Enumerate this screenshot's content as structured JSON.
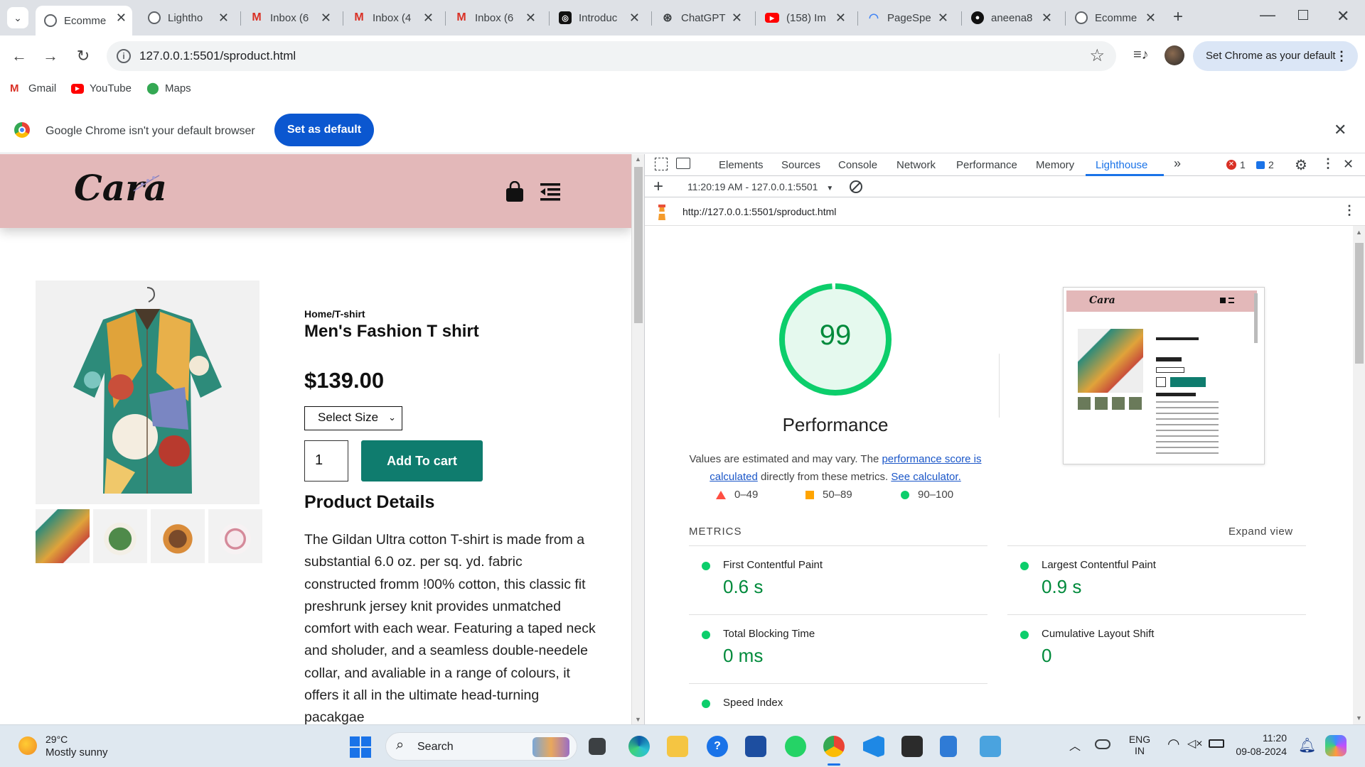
{
  "browser": {
    "tabs": [
      {
        "title": "Ecomme",
        "active": true,
        "icon": "globe-icon"
      },
      {
        "title": "Lightho",
        "active": false,
        "icon": "globe-icon"
      },
      {
        "title": "Inbox (6",
        "active": false,
        "icon": "gmail-icon"
      },
      {
        "title": "Inbox (4",
        "active": false,
        "icon": "gmail-icon"
      },
      {
        "title": "Inbox (6",
        "active": false,
        "icon": "gmail-icon"
      },
      {
        "title": "Introduc",
        "active": false,
        "icon": "openai-icon"
      },
      {
        "title": "ChatGPT",
        "active": false,
        "icon": "openai-icon"
      },
      {
        "title": "(158) Im",
        "active": false,
        "icon": "youtube-icon"
      },
      {
        "title": "PageSpe",
        "active": false,
        "icon": "pagespeed-icon"
      },
      {
        "title": "aneena8",
        "active": false,
        "icon": "github-icon"
      },
      {
        "title": "Ecomme",
        "active": false,
        "icon": "globe-icon"
      }
    ],
    "url": "127.0.0.1:5501/sproduct.html",
    "set_default_pill": "Set Chrome as your default",
    "bookmarks": [
      "Gmail",
      "YouTube",
      "Maps"
    ],
    "infobar": {
      "message": "Google Chrome isn't your default browser",
      "button": "Set as default"
    }
  },
  "site": {
    "logo": "Cara",
    "breadcrumb": "Home/T-shirt",
    "product_title": "Men's Fashion T shirt",
    "price": "$139.00",
    "size_select": "Select Size",
    "quantity": "1",
    "add_to_cart": "Add To cart",
    "details_heading": "Product Details",
    "description": "The Gildan Ultra cotton T-shirt is made from a substantial 6.0 oz. per sq. yd. fabric constructed fromm !00% cotton, this classic fit preshrunk jersey knit provides unmatched comfort with each wear. Featuring a taped neck and sholuder, and a seamless double-needele collar, and avaliable in a range of colours, it offers it all in the ultimate head-turning pacakgae"
  },
  "devtools": {
    "tabs": [
      "Elements",
      "Sources",
      "Console",
      "Network",
      "Performance",
      "Memory",
      "Lighthouse"
    ],
    "active_tab": "Lighthouse",
    "error_count": "1",
    "message_count": "2",
    "report_selector": "11:20:19 AM - 127.0.0.1:5501",
    "report_url": "http://127.0.0.1:5501/sproduct.html",
    "score": "99",
    "score_fraction": 0.99,
    "category": "Performance",
    "note_prefix": "Values are estimated and may vary. The ",
    "note_link1": "performance score is calculated",
    "note_mid": " directly from these metrics. ",
    "note_link2": "See calculator.",
    "legend": [
      "0–49",
      "50–89",
      "90–100"
    ],
    "metrics_heading": "METRICS",
    "expand_view": "Expand view",
    "metrics": [
      {
        "name": "First Contentful Paint",
        "value": "0.6 s"
      },
      {
        "name": "Largest Contentful Paint",
        "value": "0.9 s"
      },
      {
        "name": "Total Blocking Time",
        "value": "0 ms"
      },
      {
        "name": "Cumulative Layout Shift",
        "value": "0"
      },
      {
        "name": "Speed Index",
        "value": ""
      }
    ],
    "colors": {
      "pass": "#0cce6b",
      "average": "#ffa400",
      "fail": "#ff4e42",
      "accent": "#1a73e8"
    }
  },
  "taskbar": {
    "weather_temp": "29°C",
    "weather_desc": "Mostly sunny",
    "search_placeholder": "Search",
    "lang_top": "ENG",
    "lang_bottom": "IN",
    "time": "11:20",
    "date": "09-08-2024"
  }
}
